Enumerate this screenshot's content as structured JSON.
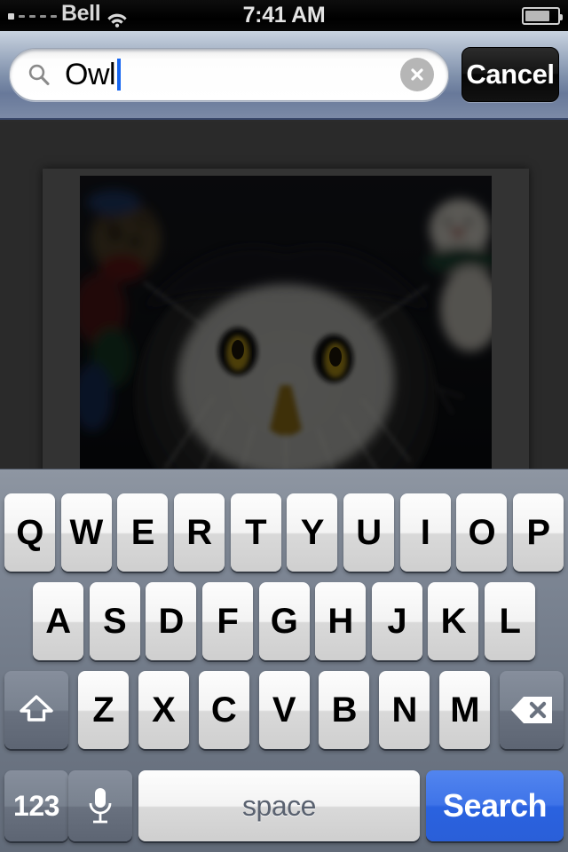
{
  "status_bar": {
    "carrier": "Bell",
    "time": "7:41 AM",
    "wifi_icon": "wifi-icon",
    "battery_icon": "battery-icon",
    "battery_level_pct": 70,
    "signal_bars_filled": 1,
    "signal_bars_total": 5
  },
  "search_bar": {
    "search_icon": "search-icon",
    "value": "Owl",
    "placeholder": "Search",
    "clear_icon": "clear-circle-icon",
    "cancel_label": "Cancel",
    "caret_color": "#1766f0",
    "cursor_visible": true
  },
  "content": {
    "photo_alt": "snowy-owl-photo",
    "frame_color": "#333333",
    "background_color": "#2a2a2a"
  },
  "keyboard": {
    "row1": [
      "Q",
      "W",
      "E",
      "R",
      "T",
      "Y",
      "U",
      "I",
      "O",
      "P"
    ],
    "row2": [
      "A",
      "S",
      "D",
      "F",
      "G",
      "H",
      "J",
      "K",
      "L"
    ],
    "row3": [
      "Z",
      "X",
      "C",
      "V",
      "B",
      "N",
      "M"
    ],
    "shift_icon": "shift-arrow-icon",
    "backspace_icon": "backspace-delete-icon",
    "numeric_label": "123",
    "mic_icon": "microphone-icon",
    "space_label": "space",
    "return_label": "Search",
    "return_color": "#3f74e8"
  }
}
